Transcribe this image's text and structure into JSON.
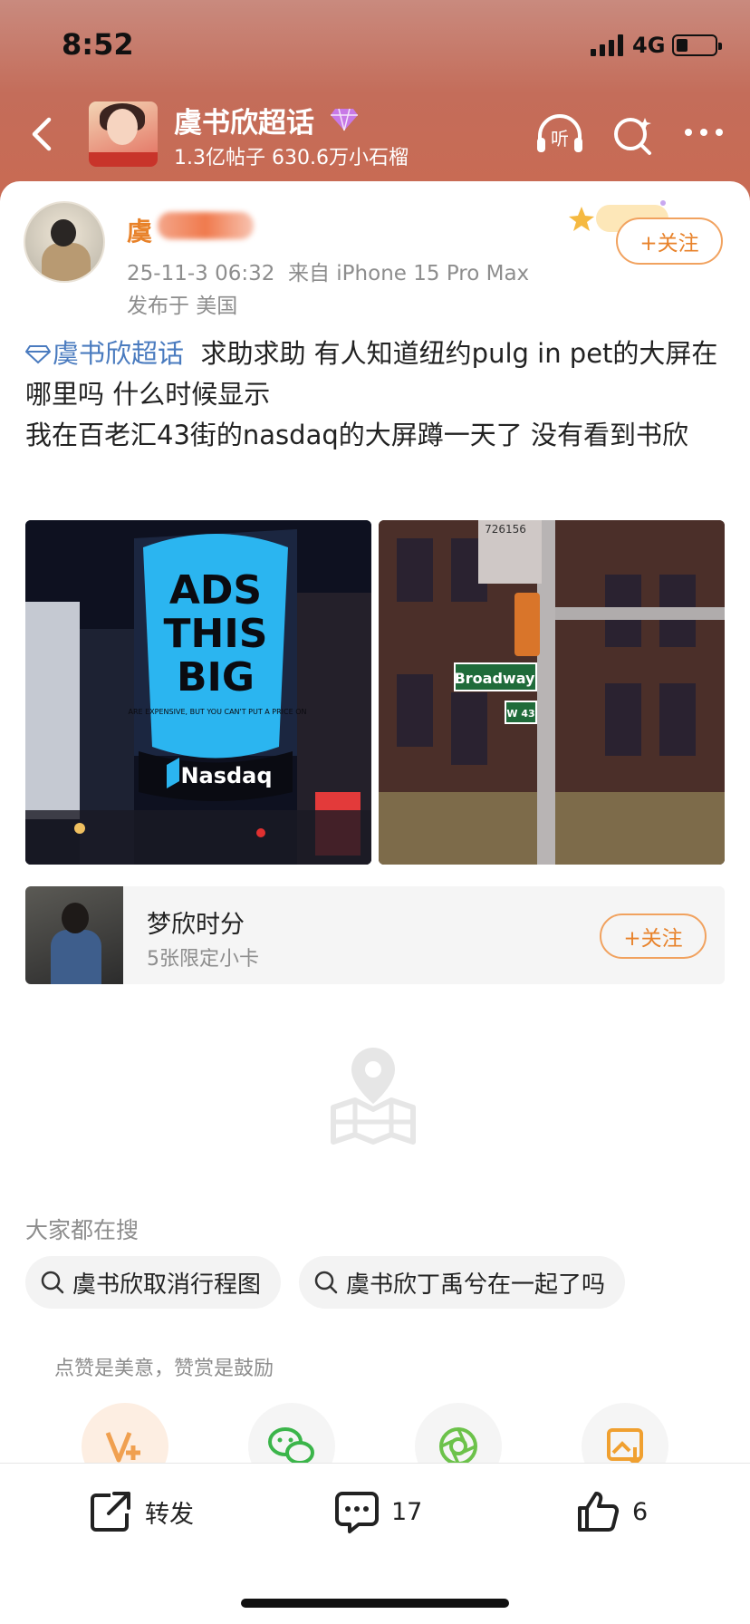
{
  "status": {
    "time": "8:52",
    "network": "4G"
  },
  "topic": {
    "title": "虞书欣超话",
    "stats": "1.3亿帖子 630.6万小石榴"
  },
  "post": {
    "username_visible": "虞",
    "meta": "25-11-3 06:32  来自 iPhone 15 Pro Max",
    "location": "发布于 美国",
    "follow_label": "+关注",
    "topic_link": "虞书欣超话",
    "text": "  求助求助 有人知道纽约pulg in pet的大屏在哪里吗 什么时候显示\n我在百老汇43街的nasdaq的大屏蹲一天了 没有看到书欣",
    "image1": {
      "billboard_lines": [
        "ADS",
        "THIS",
        "BIG"
      ],
      "billboard_sub": "ARE EXPENSIVE, BUT YOU CAN'T PUT A PRICE ON",
      "brand": "Nasdaq"
    },
    "image2": {
      "street_sign": "Broadway",
      "sign2": "W 43",
      "box_number": "726156"
    }
  },
  "sticker": {
    "name": "梦欣时分",
    "sub": "5张限定小卡",
    "follow_label": "+关注"
  },
  "search": {
    "title": "大家都在搜",
    "chips": [
      "虞书欣取消行程图",
      "虞书欣丁禹兮在一起了吗"
    ]
  },
  "reward": {
    "text": "点赞是美意，赞赏是鼓励"
  },
  "actions": {
    "repost_label": "转发",
    "comment_count": "17",
    "like_count": "6"
  },
  "colors": {
    "accent": "#e8822a",
    "topic_link": "#4a7bbf",
    "header_bg": "#c96a52"
  }
}
